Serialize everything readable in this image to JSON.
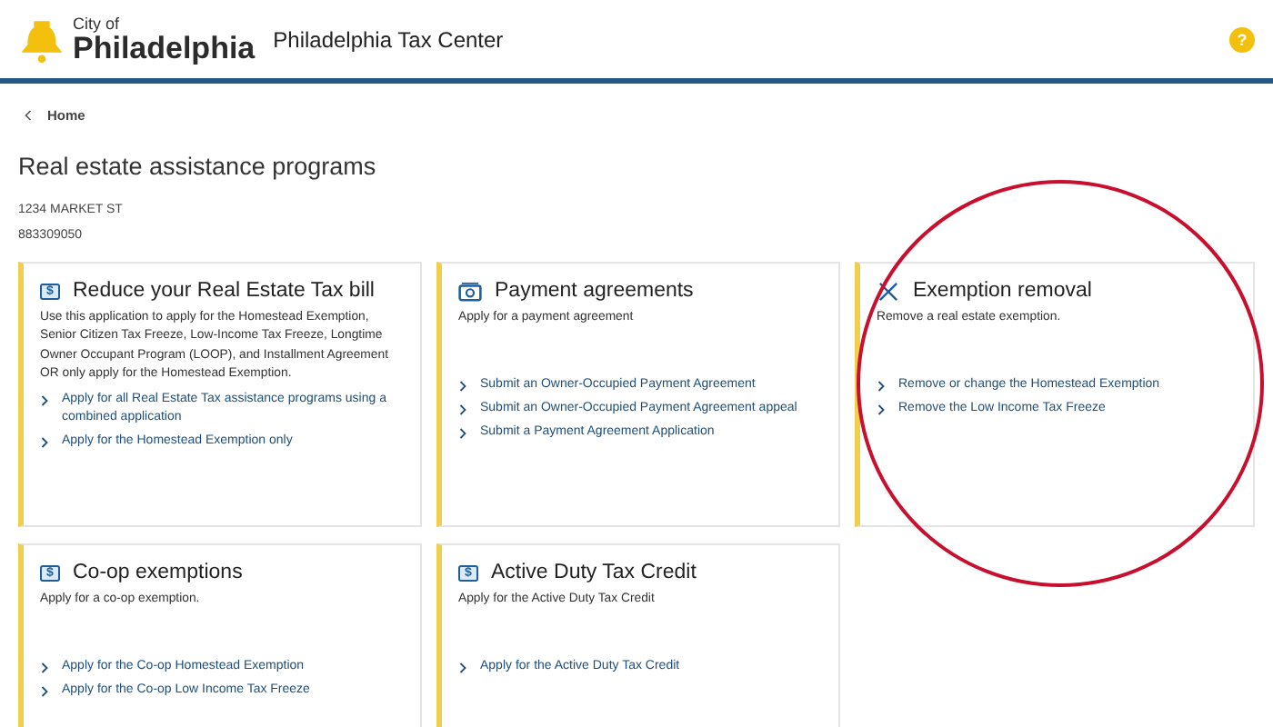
{
  "header": {
    "logo_small": "City of",
    "logo_large": "Philadelphia",
    "site_title": "Philadelphia Tax Center",
    "help": "?"
  },
  "breadcrumb": {
    "label": "Home"
  },
  "page_title": "Real estate assistance programs",
  "address": "1234 MARKET ST",
  "account": "883309050",
  "cards": [
    {
      "kind": "dollar",
      "icon_text": "$",
      "title": "Reduce your Real Estate Tax bill",
      "description": "Use this application to apply for the Homestead Exemption, Senior Citizen Tax Freeze, Low-Income Tax Freeze, Longtime Owner Occupant Program (LOOP), and Installment Agreement OR only apply for the Homestead Exemption.",
      "highlighted": false,
      "links": [
        "Apply for all Real Estate Tax assistance programs using a combined application",
        "Apply for the Homestead Exemption only"
      ]
    },
    {
      "kind": "cash",
      "title": "Payment agreements",
      "description": "Apply for a payment agreement",
      "highlighted": false,
      "links": [
        "Submit an Owner-Occupied Payment Agreement",
        "Submit an Owner-Occupied Payment Agreement appeal",
        "Submit a Payment Agreement Application"
      ]
    },
    {
      "kind": "close",
      "title": "Exemption removal",
      "description": "Remove a real estate exemption.",
      "highlighted": true,
      "links": [
        "Remove or change the Homestead Exemption",
        "Remove the Low Income Tax Freeze"
      ]
    },
    {
      "kind": "dollar",
      "icon_text": "$",
      "title": "Co-op exemptions",
      "description": "Apply for a co-op exemption.",
      "highlighted": false,
      "links": [
        "Apply for the Co-op Homestead Exemption",
        "Apply for the Co-op Low Income Tax Freeze"
      ]
    },
    {
      "kind": "dollar",
      "icon_text": "$",
      "title": "Active Duty Tax Credit",
      "description": "Apply for the Active Duty Tax Credit",
      "highlighted": false,
      "links": [
        "Apply for the Active Duty Tax Credit"
      ]
    }
  ]
}
